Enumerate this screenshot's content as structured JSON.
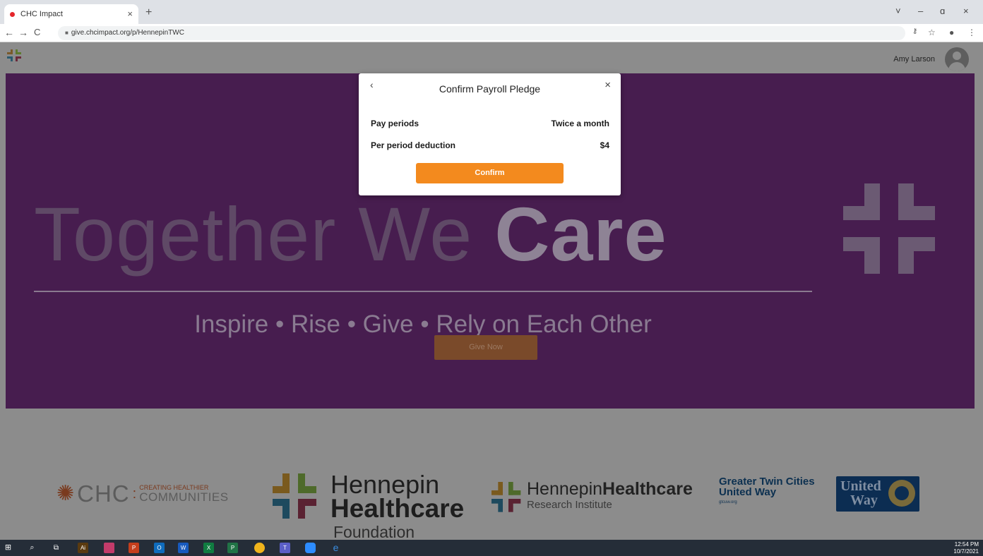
{
  "browser": {
    "tab_title": "CHC Impact",
    "tab_close": "×",
    "new_tab": "+",
    "url": "give.chcimpact.org/p/HennepinTWC",
    "window_controls": {
      "minimize": "–",
      "maximize": "ɑ",
      "close": "×",
      "tabs_menu": "˅"
    }
  },
  "header": {
    "user_name": "Amy Larson"
  },
  "hero": {
    "title_part1": "Together We ",
    "title_part2": "Care",
    "tagline": "Inspire  •  Rise  •  Give  •  Rely on Each Other",
    "give_now_label": "Give Now"
  },
  "modal": {
    "title": "Confirm Payroll Pledge",
    "back_icon": "‹",
    "close_icon": "×",
    "rows": [
      {
        "label": "Pay periods",
        "value": "Twice a month"
      },
      {
        "label": "Per period deduction",
        "value": "$4"
      }
    ],
    "confirm_label": "Confirm"
  },
  "partners": {
    "chc": {
      "abbr": "CHC",
      "tag_top": "CREATING HEALTHIER",
      "tag_bottom": "COMMUNITIES"
    },
    "hhf": {
      "line1": "Hennepin",
      "line2": "Healthcare",
      "line3": "Foundation"
    },
    "hhri": {
      "line1a": "Hennepin",
      "line1b": "Healthcare",
      "line2": "Research Institute"
    },
    "gtcuw": {
      "line1": "Greater Twin Cities",
      "line2": "United Way",
      "line3": "gtcuw.org"
    },
    "uw": {
      "line1": "United",
      "line2": "Way"
    }
  },
  "taskbar": {
    "time": "12:54 PM",
    "date": "10/7/2021"
  },
  "colors": {
    "hero_bg": "#471d4f",
    "accent_orange": "#f38a1e",
    "overlay": "#8c8c8c"
  }
}
